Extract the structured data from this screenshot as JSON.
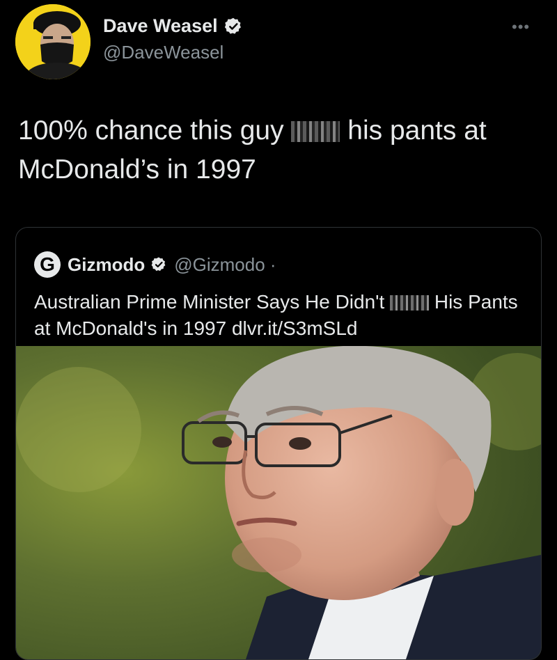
{
  "tweet": {
    "display_name": "Dave Weasel",
    "handle": "@DaveWeasel",
    "more_label": "•••",
    "text_before": "100% chance this guy",
    "text_after": "his pants at McDonald’s in 1997"
  },
  "quote": {
    "logo_letter": "G",
    "display_name": "Gizmodo",
    "handle": "@Gizmodo ·",
    "text_before": "Australian Prime Minister Says He Didn't",
    "text_after": "His Pants at McDonald's in 1997 dlvr.it/S3mSLd"
  },
  "icons": {
    "verified": "verified-badge-icon",
    "more": "more-options-icon"
  },
  "colors": {
    "background": "#000000",
    "text_primary": "#e7e9ea",
    "text_secondary": "#8b949a",
    "avatar_bg": "#f3d21a"
  }
}
